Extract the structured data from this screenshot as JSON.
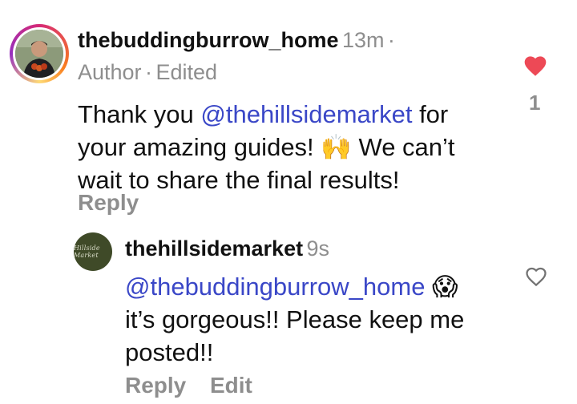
{
  "comments": [
    {
      "username": "thebuddingburrow_home",
      "time": "13m",
      "dot": "·",
      "role": "Author",
      "separator": "·",
      "edited": "Edited",
      "text_before_mention": "Thank you ",
      "mention": "@thehillsidemarket",
      "text_line1_after": " for",
      "text_line2_before_emoji": "your amazing guides! ",
      "emoji": "🙌",
      "text_line2_after_emoji": " We can’t",
      "text_line3": "wait to share the final results!",
      "reply_label": "Reply",
      "like_count": "1",
      "liked": true,
      "heart_color": "#ed4956"
    },
    {
      "username": "thehillsidemarket",
      "time": "9s",
      "avatar_text": "Hillside Market",
      "mention": "@thebuddingburrow_home",
      "emoji": "😱",
      "text_line2": "it’s gorgeous!! Please keep me",
      "text_line3": "posted!!",
      "reply_label": "Reply",
      "edit_label": "Edit",
      "liked": false
    }
  ],
  "icons": {
    "like_filled": "heart-filled-icon",
    "like_outline": "heart-outline-icon"
  }
}
